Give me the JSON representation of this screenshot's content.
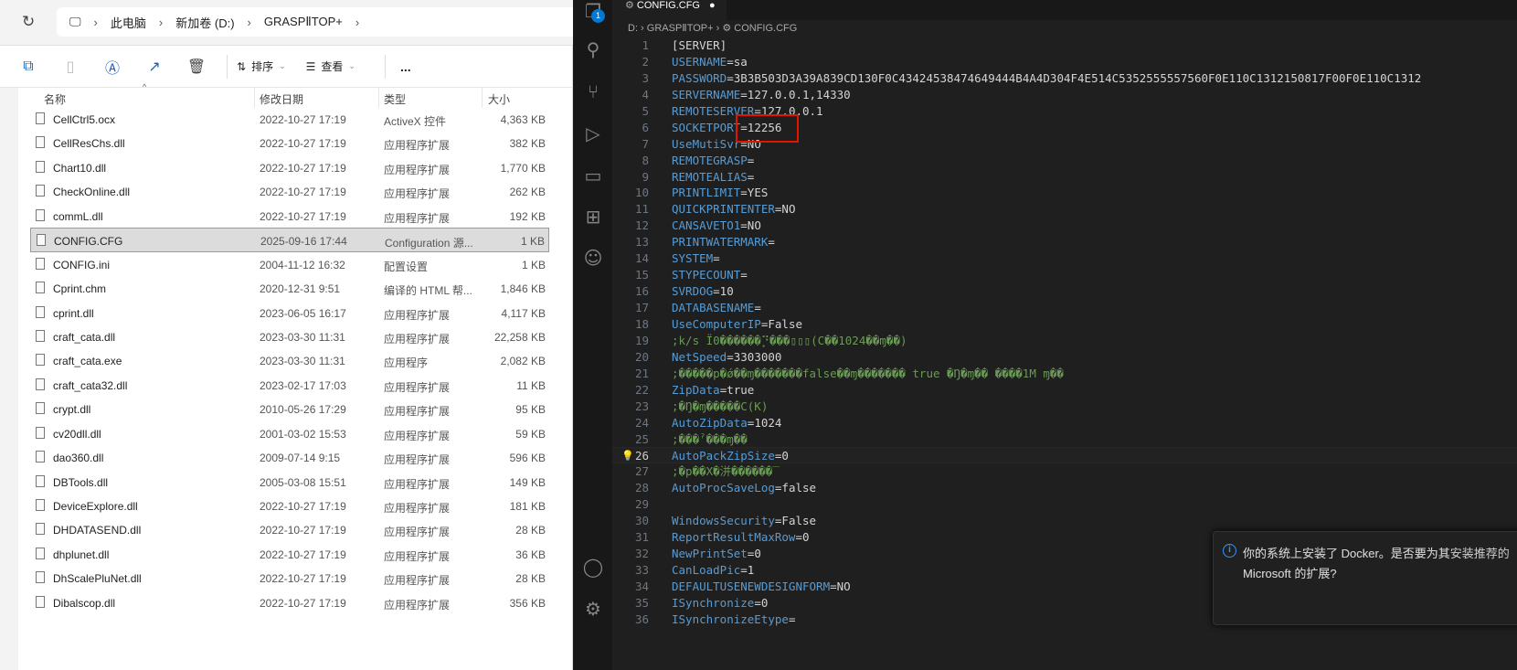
{
  "explorer": {
    "breadcrumb": [
      "此电脑",
      "新加卷 (D:)",
      "GRASPⅡTOP+"
    ],
    "toolbar": {
      "sort": "排序",
      "view": "查看",
      "more": "..."
    },
    "columns": [
      "名称",
      "修改日期",
      "类型",
      "大小"
    ],
    "files": [
      {
        "name": "CellCtrl5.ocx",
        "date": "2022-10-27 17:19",
        "type": "ActiveX 控件",
        "size": "4,363 KB"
      },
      {
        "name": "CellResChs.dll",
        "date": "2022-10-27 17:19",
        "type": "应用程序扩展",
        "size": "382 KB"
      },
      {
        "name": "Chart10.dll",
        "date": "2022-10-27 17:19",
        "type": "应用程序扩展",
        "size": "1,770 KB"
      },
      {
        "name": "CheckOnline.dll",
        "date": "2022-10-27 17:19",
        "type": "应用程序扩展",
        "size": "262 KB"
      },
      {
        "name": "commL.dll",
        "date": "2022-10-27 17:19",
        "type": "应用程序扩展",
        "size": "192 KB"
      },
      {
        "name": "CONFIG.CFG",
        "date": "2025-09-16 17:44",
        "type": "Configuration 源...",
        "size": "1 KB",
        "selected": true
      },
      {
        "name": "CONFIG.ini",
        "date": "2004-11-12 16:32",
        "type": "配置设置",
        "size": "1 KB"
      },
      {
        "name": "Cprint.chm",
        "date": "2020-12-31 9:51",
        "type": "编译的 HTML 帮...",
        "size": "1,846 KB"
      },
      {
        "name": "cprint.dll",
        "date": "2023-06-05 16:17",
        "type": "应用程序扩展",
        "size": "4,117 KB"
      },
      {
        "name": "craft_cata.dll",
        "date": "2023-03-30 11:31",
        "type": "应用程序扩展",
        "size": "22,258 KB"
      },
      {
        "name": "craft_cata.exe",
        "date": "2023-03-30 11:31",
        "type": "应用程序",
        "size": "2,082 KB"
      },
      {
        "name": "craft_cata32.dll",
        "date": "2023-02-17 17:03",
        "type": "应用程序扩展",
        "size": "11 KB"
      },
      {
        "name": "crypt.dll",
        "date": "2010-05-26 17:29",
        "type": "应用程序扩展",
        "size": "95 KB"
      },
      {
        "name": "cv20dll.dll",
        "date": "2001-03-02 15:53",
        "type": "应用程序扩展",
        "size": "59 KB"
      },
      {
        "name": "dao360.dll",
        "date": "2009-07-14 9:15",
        "type": "应用程序扩展",
        "size": "596 KB"
      },
      {
        "name": "DBTools.dll",
        "date": "2005-03-08 15:51",
        "type": "应用程序扩展",
        "size": "149 KB"
      },
      {
        "name": "DeviceExplore.dll",
        "date": "2022-10-27 17:19",
        "type": "应用程序扩展",
        "size": "181 KB"
      },
      {
        "name": "DHDATASEND.dll",
        "date": "2022-10-27 17:19",
        "type": "应用程序扩展",
        "size": "28 KB"
      },
      {
        "name": "dhplunet.dll",
        "date": "2022-10-27 17:19",
        "type": "应用程序扩展",
        "size": "36 KB"
      },
      {
        "name": "DhScalePluNet.dll",
        "date": "2022-10-27 17:19",
        "type": "应用程序扩展",
        "size": "28 KB"
      },
      {
        "name": "Dibalscop.dll",
        "date": "2022-10-27 17:19",
        "type": "应用程序扩展",
        "size": "356 KB"
      }
    ]
  },
  "editor": {
    "tab": "CONFIG.CFG",
    "explorer_badge": "1",
    "breadcrumb": [
      "D:",
      "GRASPⅡTOP+",
      "CONFIG.CFG"
    ],
    "lines": [
      {
        "k": "[SERVER]",
        "v": "",
        "type": "section"
      },
      {
        "k": "USERNAME",
        "v": "=sa"
      },
      {
        "k": "PASSWORD",
        "v": "=3B3B503D3A39A839CD130F0C43424538474649444B4A4D304F4E514C5352555557560F0E110C1312150817F00F0E110C1312"
      },
      {
        "k": "SERVERNAME",
        "v": "=127.0.0.1,14330"
      },
      {
        "k": "REMOTESERVER",
        "v": "=127.0.0.1"
      },
      {
        "k": "SOCKETPORT",
        "v": "=12256"
      },
      {
        "k": "UseMutiSvr",
        "v": "=NO"
      },
      {
        "k": "REMOTEGRASP",
        "v": "="
      },
      {
        "k": "REMOTEALIAS",
        "v": "="
      },
      {
        "k": "PRINTLIMIT",
        "v": "=YES"
      },
      {
        "k": "QUICKPRINTENTER",
        "v": "=NO"
      },
      {
        "k": "CANSAVETO1",
        "v": "=NO"
      },
      {
        "k": "PRINTWATERMARK",
        "v": "="
      },
      {
        "k": "SYSTEM",
        "v": "="
      },
      {
        "k": "STYPECOUNT",
        "v": "="
      },
      {
        "k": "SVRDOG",
        "v": "=10"
      },
      {
        "k": "DATABASENAME",
        "v": "="
      },
      {
        "k": "UseComputerIP",
        "v": "=False"
      },
      {
        "c": ";k/s Ï0������⡙���▯▯▯(C��1024��ɱ��)"
      },
      {
        "k": "NetSpeed",
        "v": "=3303000"
      },
      {
        "c": ";�����p�ǿ��ɱ�������false��ɱ������� true �Ŋ�ɱ�� ����1M ɱ��"
      },
      {
        "k": "ZipData",
        "v": "=true"
      },
      {
        "c": ";�Ŋ�ɱ�����C(K)"
      },
      {
        "k": "AutoZipData",
        "v": "=1024"
      },
      {
        "c": ";���ˀ���ɱ��"
      },
      {
        "k": "AutoPackZipSize",
        "v": "=0",
        "current": true
      },
      {
        "c": ";�p��X�洴������‾"
      },
      {
        "k": "AutoProcSaveLog",
        "v": "=false"
      },
      {
        "k": "",
        "v": ""
      },
      {
        "k": "WindowsSecurity",
        "v": "=False"
      },
      {
        "k": "ReportResultMaxRow",
        "v": "=0"
      },
      {
        "k": "NewPrintSet",
        "v": "=0"
      },
      {
        "k": "CanLoadPic",
        "v": "=1"
      },
      {
        "k": "DEFAULTUSENEWDESIGNFORM",
        "v": "=NO"
      },
      {
        "k": "ISynchronize",
        "v": "=0"
      },
      {
        "k": "ISynchronizeEtype",
        "v": "="
      }
    ]
  },
  "notification": {
    "message": "你的系统上安装了 Docker。是否要为其安装推荐的 Microsoft 的扩展?",
    "visible_line1": "你的系统上安装了 Docker。是否要为其",
    "visible_line2": "Microsoft 的扩展?"
  },
  "colors": {
    "highlight_box": "#e51400",
    "key": "#569cd6",
    "comment": "#6a9955",
    "accent": "#0078d4"
  }
}
